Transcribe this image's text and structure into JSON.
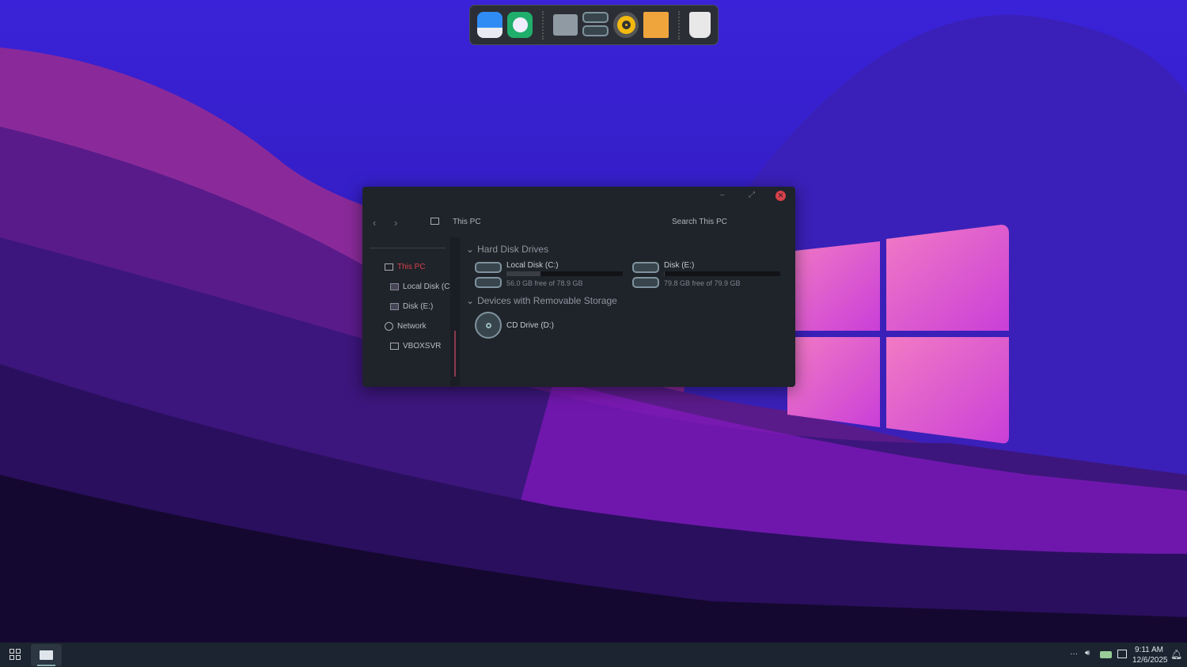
{
  "dock": {
    "apps": [
      {
        "icon": "finder-icon",
        "color": "#2f8cf5"
      },
      {
        "icon": "browser-planet-icon",
        "color": "#1fae6b"
      },
      {
        "icon": "folder-icon",
        "color": "#8f9aa3"
      },
      {
        "icon": "drives-icon",
        "color": "#6a7d88"
      },
      {
        "icon": "speaker-icon",
        "color": "#f3b90f"
      },
      {
        "icon": "mixer-icon",
        "color": "#f0a53c"
      },
      {
        "icon": "trash-icon",
        "color": "#e8e8e8"
      }
    ]
  },
  "window": {
    "location": "This PC",
    "search_placeholder": "Search This PC",
    "sidebar": [
      {
        "label": "This PC",
        "icon": "monitor-icon",
        "active": true
      },
      {
        "label": "Local Disk (C:)",
        "icon": "drive-icon"
      },
      {
        "label": "Disk (E:)",
        "icon": "drive-icon"
      },
      {
        "label": "Network",
        "icon": "network-icon"
      },
      {
        "label": "VBOXSVR",
        "icon": "monitor-icon"
      }
    ],
    "sections": {
      "hdd": "Hard Disk Drives",
      "removable": "Devices with Removable Storage"
    },
    "drives": [
      {
        "name": "Local Disk (C:)",
        "free": "56.0 GB free of 78.9 GB",
        "used_fraction": 0.29
      },
      {
        "name": "Disk (E:)",
        "free": "79.8 GB free of 79.9 GB",
        "used_fraction": 0.001
      }
    ],
    "removable": [
      {
        "name": "CD Drive (D:)"
      }
    ],
    "accent": "#d8414a"
  },
  "taskbar": {
    "time": "9:11 AM",
    "date": "12/6/2025",
    "overflow": "···"
  }
}
